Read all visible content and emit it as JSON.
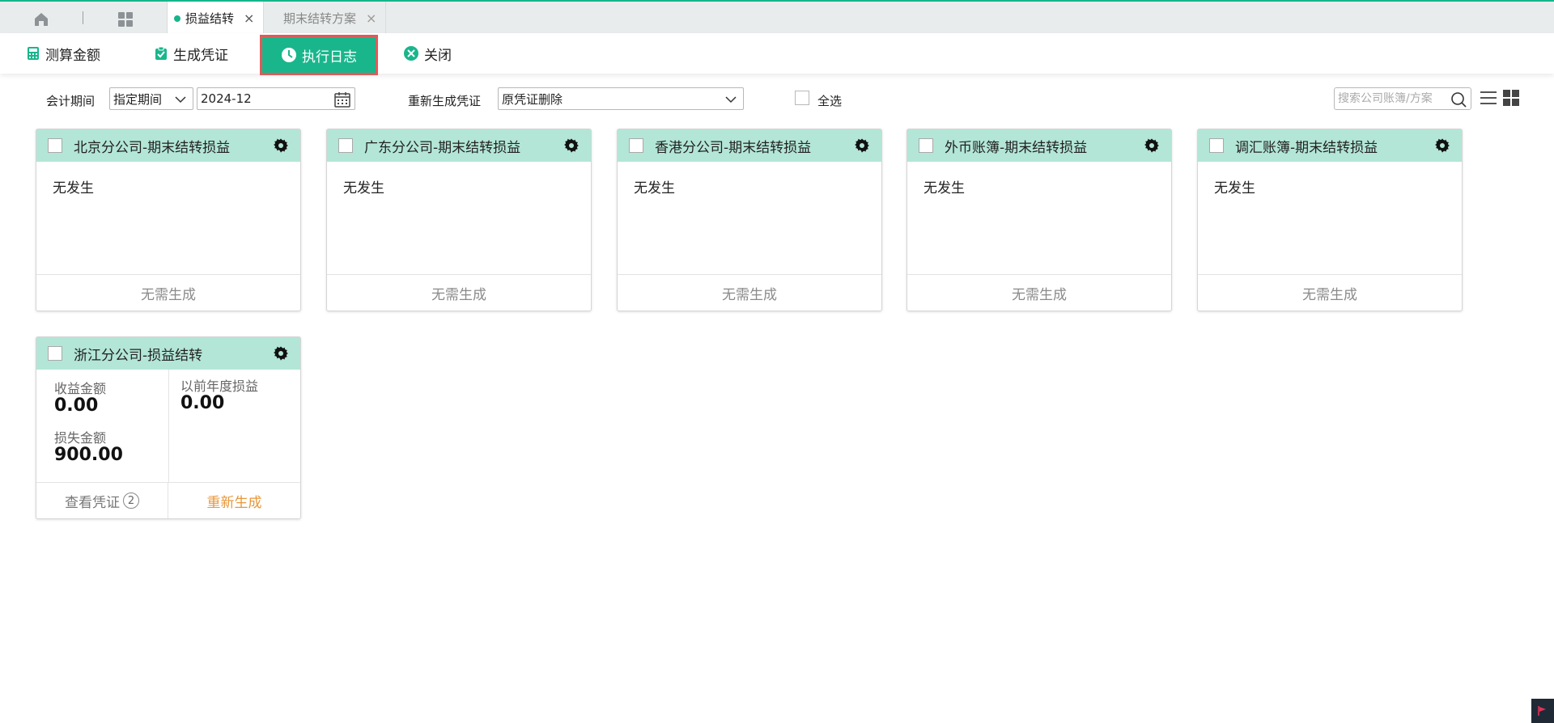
{
  "tabs": {
    "active": {
      "label": "损益结转",
      "close": "×"
    },
    "inactive": {
      "label": "期末结转方案",
      "close": "×"
    }
  },
  "toolbar": {
    "calc_label": "测算金额",
    "gen_label": "生成凭证",
    "log_label": "执行日志",
    "close_label": "关闭"
  },
  "filters": {
    "period_label": "会计期间",
    "period_mode": "指定期间",
    "period_value": "2024-12",
    "regen_label": "重新生成凭证",
    "regen_mode": "原凭证删除",
    "select_all_label": "全选",
    "search_placeholder": "搜索公司账簿/方案"
  },
  "cards": [
    {
      "title": "北京分公司-期末结转损益",
      "status": "无发生",
      "footer": "无需生成"
    },
    {
      "title": "广东分公司-期末结转损益",
      "status": "无发生",
      "footer": "无需生成"
    },
    {
      "title": "香港分公司-期末结转损益",
      "status": "无发生",
      "footer": "无需生成"
    },
    {
      "title": "外币账簿-期末结转损益",
      "status": "无发生",
      "footer": "无需生成"
    },
    {
      "title": "调汇账簿-期末结转损益",
      "status": "无发生",
      "footer": "无需生成"
    }
  ],
  "detail_card": {
    "title": "浙江分公司-损益结转",
    "income_label": "收益金额",
    "income_value": "0.00",
    "loss_label": "损失金额",
    "loss_value": "900.00",
    "prior_label": "以前年度损益",
    "prior_value": "0.00",
    "view_label": "查看凭证",
    "view_count": "2",
    "regen_label": "重新生成"
  },
  "colors": {
    "accent": "#19b68c",
    "card_header": "#b3e6d7",
    "highlight_border": "#e05a5a",
    "regen_text": "#e8973a"
  }
}
